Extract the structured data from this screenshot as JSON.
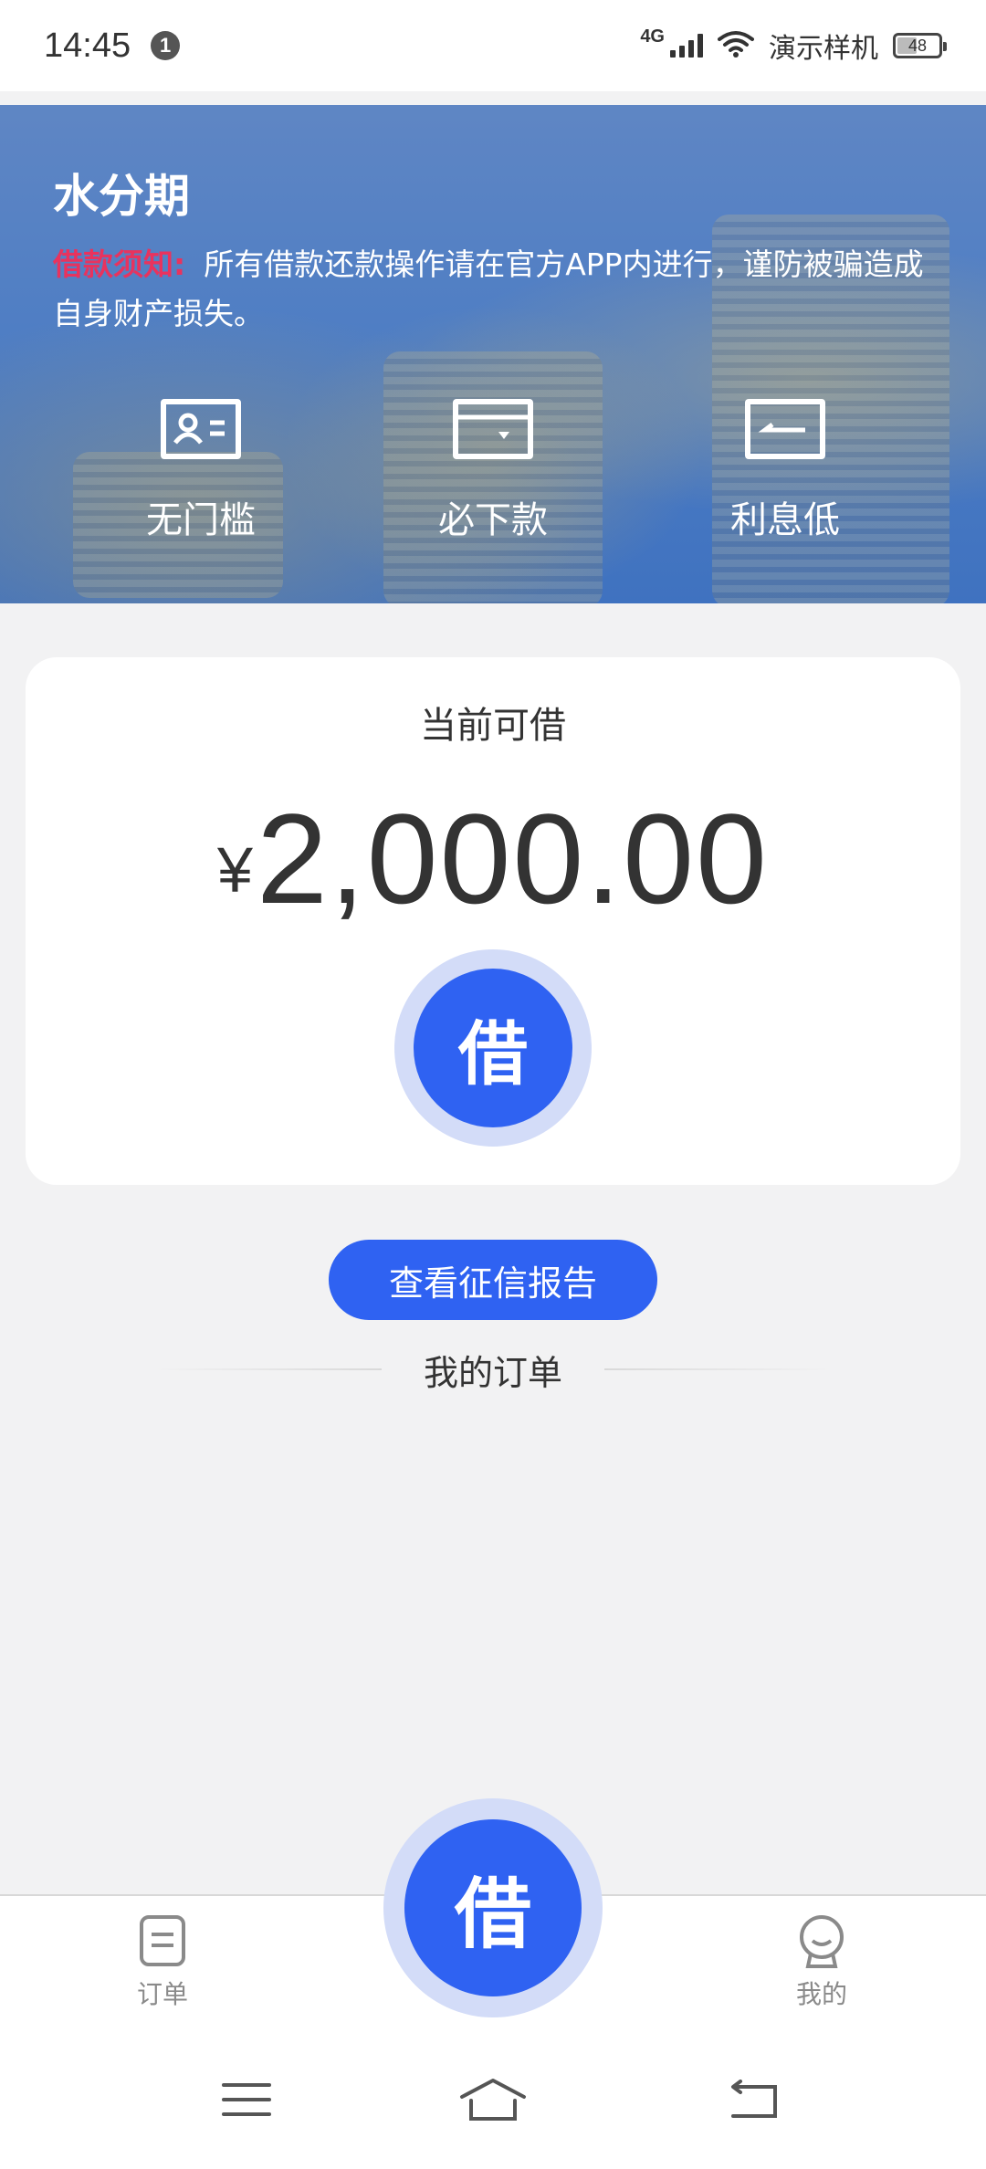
{
  "status_bar": {
    "time": "14:45",
    "notification_count": "1",
    "network": "4G",
    "carrier": "演示样机",
    "battery": "48"
  },
  "banner": {
    "app_title": "水分期",
    "notice_label": "借款须知:",
    "notice_text": "所有借款还款操作请在官方APP内进行，谨防被骗造成自身财产损失。",
    "features": [
      {
        "label": "无门槛",
        "icon": "id-card-icon"
      },
      {
        "label": "必下款",
        "icon": "wallet-icon"
      },
      {
        "label": "利息低",
        "icon": "rate-icon"
      }
    ]
  },
  "loan_card": {
    "label": "当前可借",
    "currency": "¥",
    "amount": "2,000.00",
    "borrow_button": "借"
  },
  "credit_report_button": "查看征信报告",
  "orders_section": {
    "title": "我的订单"
  },
  "tab_bar": {
    "orders_label": "订单",
    "center_button": "借",
    "mine_label": "我的"
  },
  "colors": {
    "primary": "#2f62f2",
    "primary_light": "#d3dcf8",
    "notice_red": "#e8335e",
    "background": "#f2f2f3"
  }
}
